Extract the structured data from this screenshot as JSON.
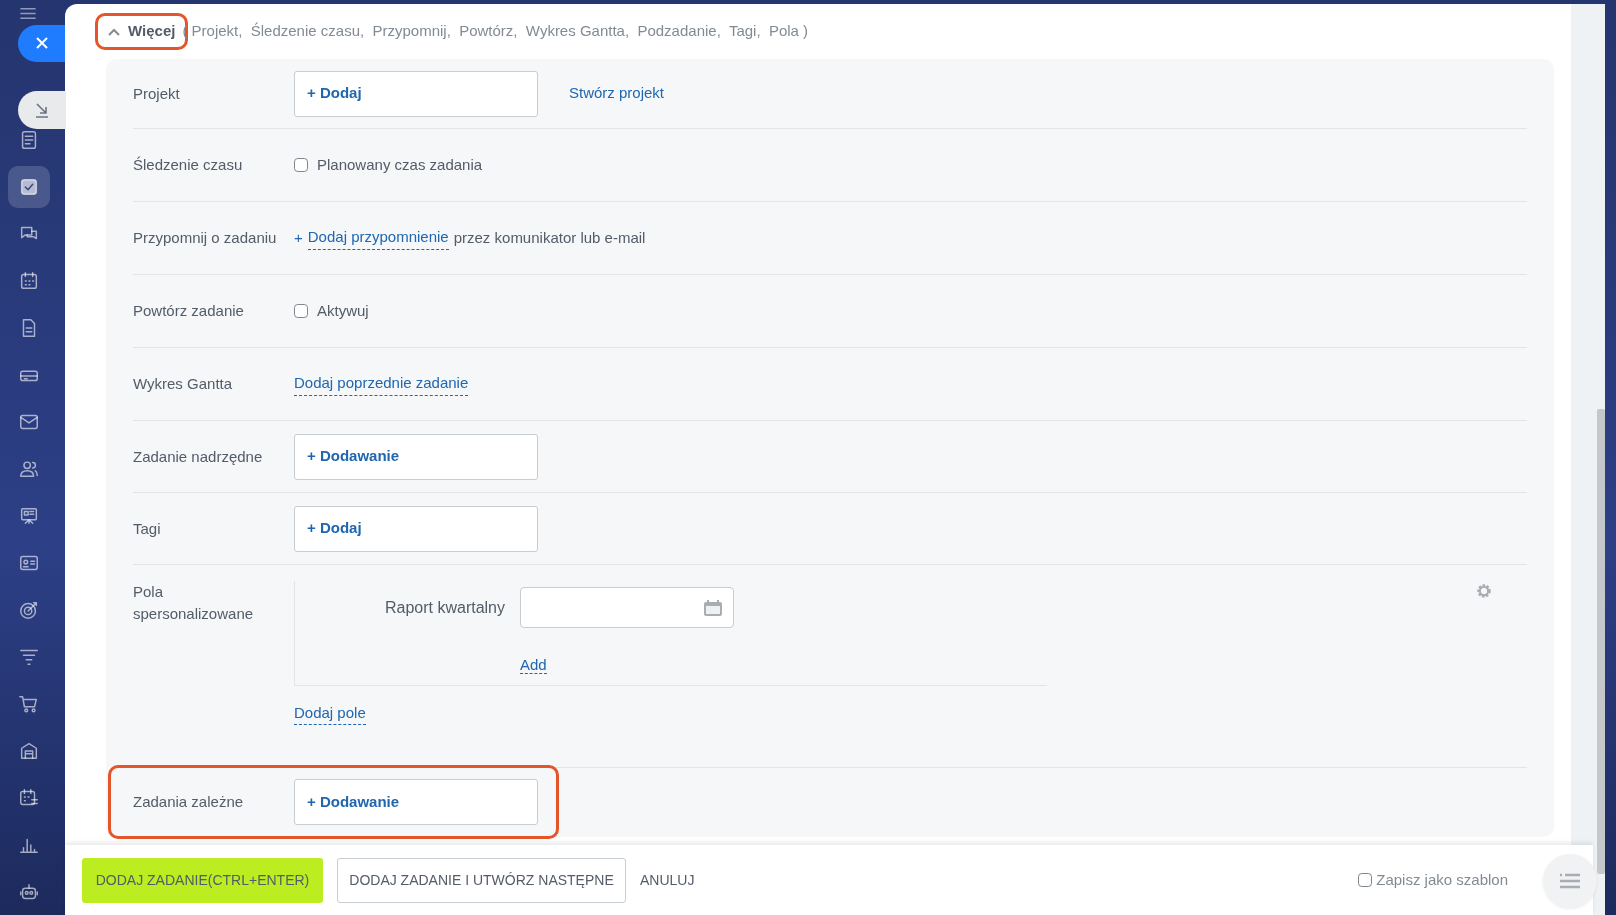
{
  "sidebar": {
    "items": [
      {
        "kind": "feed",
        "selected": false
      },
      {
        "kind": "tasks",
        "selected": true
      },
      {
        "kind": "chat",
        "selected": false
      },
      {
        "kind": "calendar",
        "selected": false
      },
      {
        "kind": "document",
        "selected": false
      },
      {
        "kind": "drive",
        "selected": false
      },
      {
        "kind": "mail",
        "selected": false
      },
      {
        "kind": "contacts",
        "selected": false
      },
      {
        "kind": "board",
        "selected": false
      },
      {
        "kind": "card",
        "selected": false
      },
      {
        "kind": "target",
        "selected": false
      },
      {
        "kind": "funnel",
        "selected": false
      },
      {
        "kind": "cart",
        "selected": false
      },
      {
        "kind": "store",
        "selected": false
      },
      {
        "kind": "schedule",
        "selected": false
      },
      {
        "kind": "chart",
        "selected": false
      },
      {
        "kind": "robot",
        "selected": false
      }
    ]
  },
  "more": {
    "toggle": "Więcej",
    "expanded": true,
    "highlighted": true,
    "summary": "( Projekt,  Śledzenie czasu,  Przypomnij,  Powtórz,  Wykres Gantta,  Podzadanie,  Tagi,  Pola )"
  },
  "rows": [
    {
      "kind": "picker",
      "label": "Projekt",
      "button": "+ Dodaj",
      "link": "Stwórz projekt",
      "highlighted": false
    },
    {
      "kind": "checkbox",
      "label": "Śledzenie czasu",
      "checked": false,
      "text": "Planowany czas zadania"
    },
    {
      "kind": "reminder",
      "label": "Przypomnij o zadaniu",
      "prefix": "+",
      "link": "Dodaj przypomnienie",
      "text": "przez komunikator lub e-mail"
    },
    {
      "kind": "checkbox",
      "label": "Powtórz zadanie",
      "checked": false,
      "text": "Aktywuj"
    },
    {
      "kind": "link",
      "label": "Wykres Gantta",
      "link": "Dodaj poprzednie zadanie"
    },
    {
      "kind": "picker",
      "label": "Zadanie nadrzędne",
      "button": "+ Dodawanie",
      "highlighted": false
    },
    {
      "kind": "picker",
      "label": "Tagi",
      "button": "+ Dodaj",
      "highlighted": false
    },
    {
      "kind": "custom",
      "label": "Pola spersonalizowane",
      "fields": [
        {
          "label": "Raport kwartalny"
        }
      ],
      "add": "Add",
      "add_field": "Dodaj pole"
    },
    {
      "kind": "picker",
      "label": "Zadania zależne",
      "button": "+ Dodawanie",
      "highlighted": true
    }
  ],
  "footer": {
    "primary": "DODAJ ZADANIE(CTRL+ENTER)",
    "secondary": "DODAJ ZADANIE I UTWÓRZ NASTĘPNE",
    "cancel": "ANULUJ",
    "template": {
      "label": "Zapisz jako szablon",
      "checked": false
    }
  }
}
